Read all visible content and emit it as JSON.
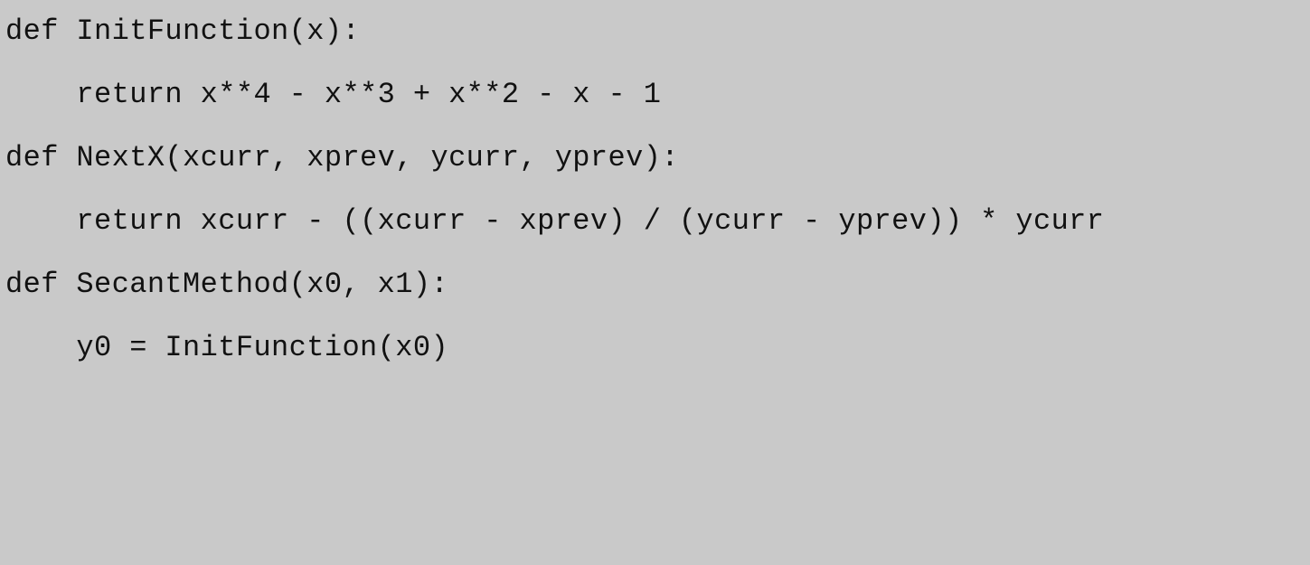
{
  "code": {
    "lines": [
      "def InitFunction(x):",
      "    return x**4 - x**3 + x**2 - x - 1",
      "",
      "",
      "def NextX(xcurr, xprev, ycurr, yprev):",
      "    return xcurr - ((xcurr - xprev) / (ycurr - yprev)) * ycurr",
      "",
      "",
      "def SecantMethod(x0, x1):",
      "    y0 = InitFunction(x0)"
    ]
  }
}
